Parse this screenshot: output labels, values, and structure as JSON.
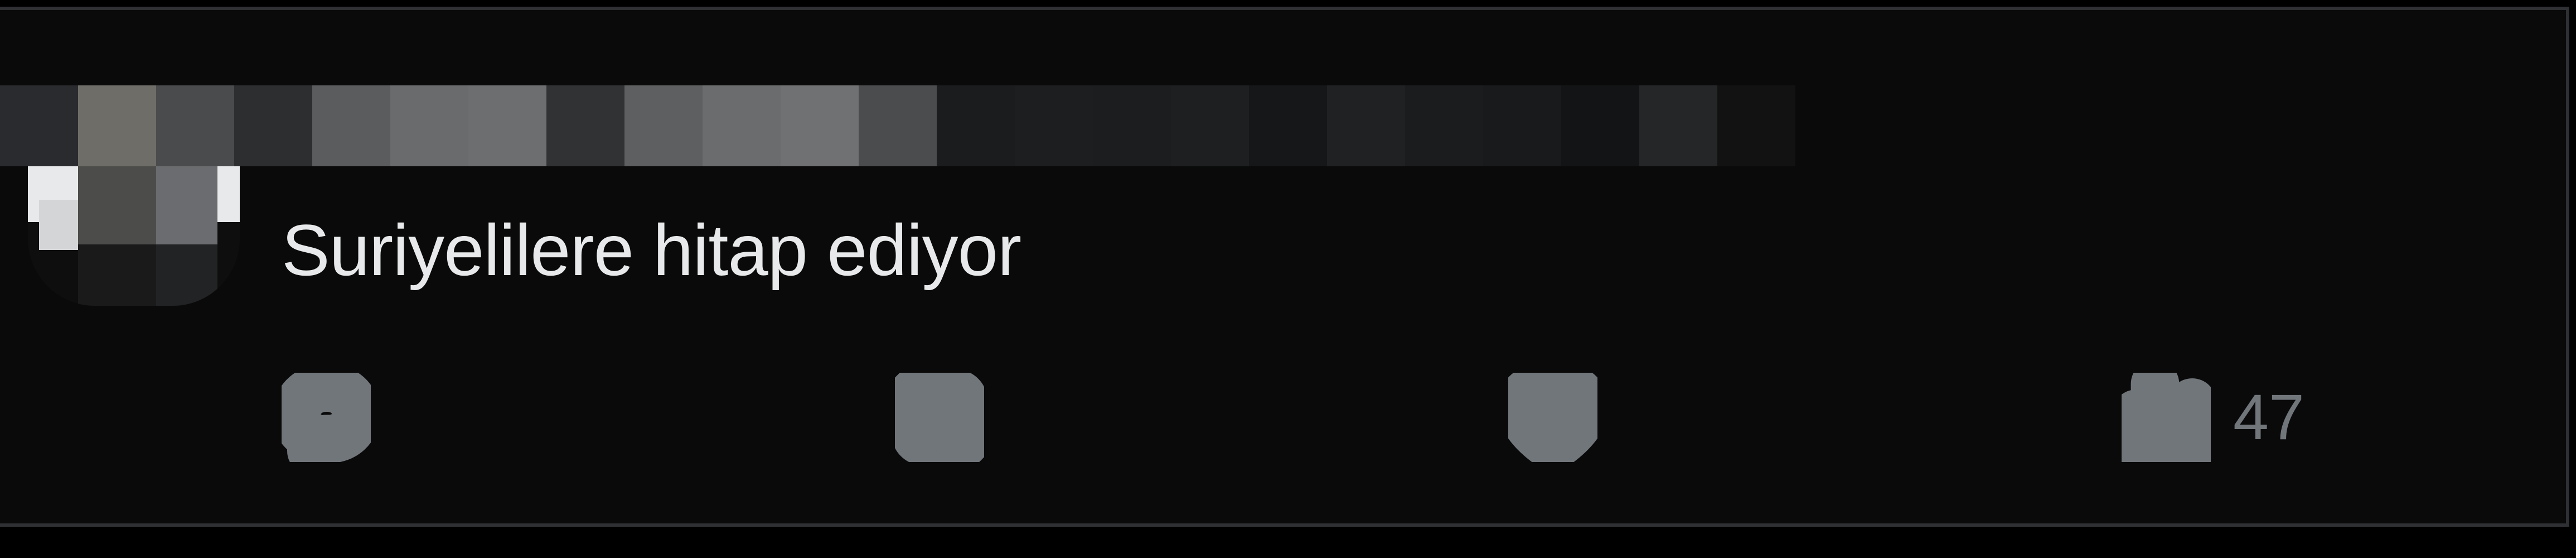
{
  "tweet": {
    "text": "Suriyelilere hitap ediyor",
    "redacted_header": true,
    "redacted_avatar": true
  },
  "actions": {
    "reply": {
      "icon": "reply-icon",
      "count": ""
    },
    "retweet": {
      "icon": "retweet-icon",
      "count": ""
    },
    "like": {
      "icon": "heart-icon",
      "count": ""
    },
    "views": {
      "icon": "views-icon",
      "count": "47"
    }
  },
  "colors": {
    "background": "#0a0a0a",
    "text": "#e7e9ea",
    "icon": "#71767b",
    "border": "#2e3033"
  }
}
